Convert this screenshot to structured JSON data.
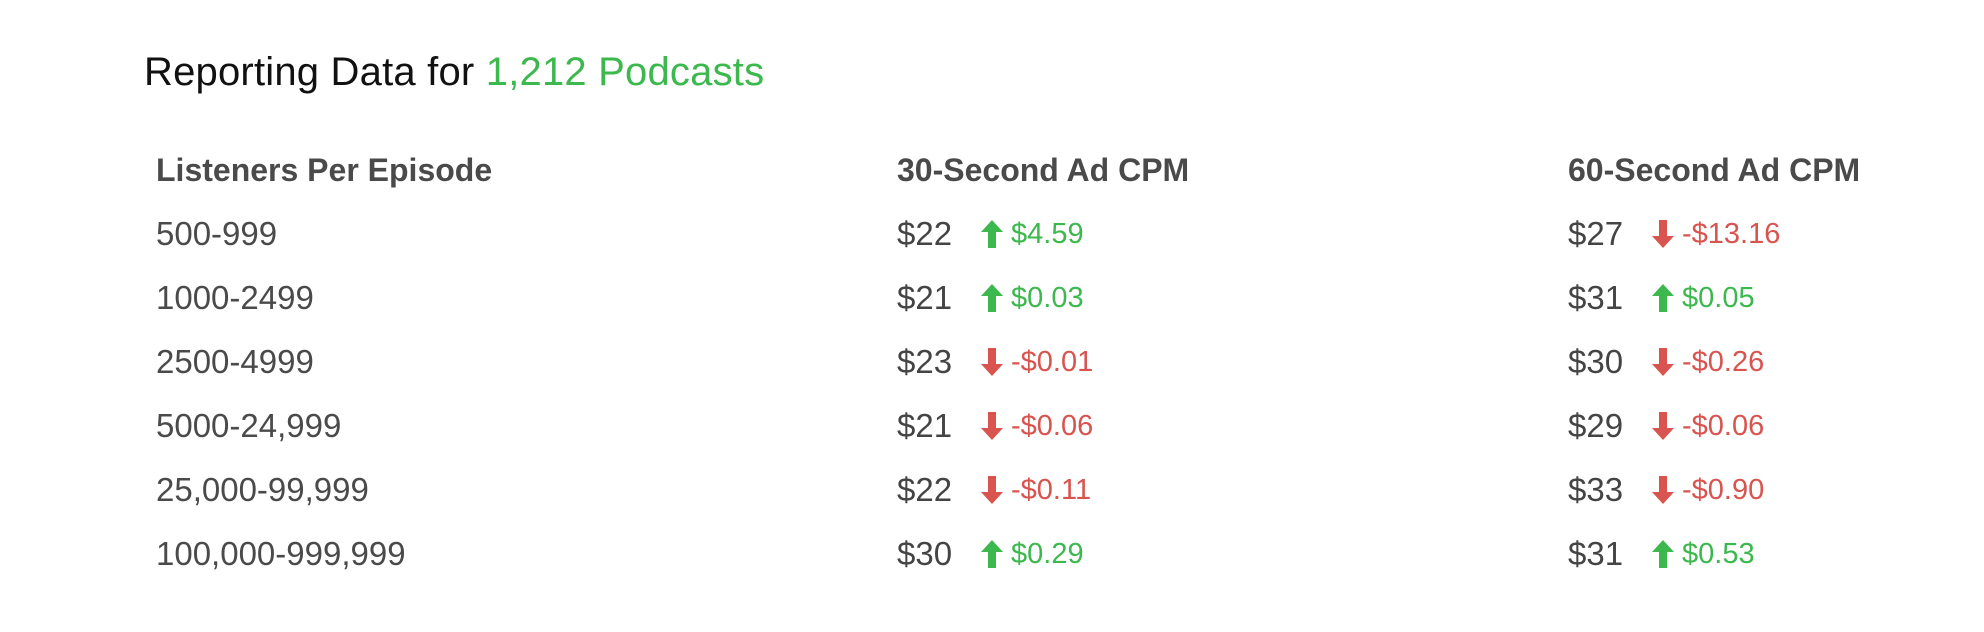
{
  "title": {
    "prefix": "Reporting Data for ",
    "highlight": "1,212 Podcasts"
  },
  "colors": {
    "up": "#3cb84f",
    "down": "#d9534f",
    "text": "#4a4a4a"
  },
  "icons": {
    "up": "arrow-up-icon",
    "down": "arrow-down-icon"
  },
  "table": {
    "headers": [
      "Listeners Per Episode",
      "30-Second Ad CPM",
      "60-Second Ad CPM"
    ],
    "rows": [
      {
        "listeners": "500-999",
        "cpm30": {
          "price": "$22",
          "change": "$4.59",
          "direction": "up"
        },
        "cpm60": {
          "price": "$27",
          "change": "-$13.16",
          "direction": "down"
        }
      },
      {
        "listeners": "1000-2499",
        "cpm30": {
          "price": "$21",
          "change": "$0.03",
          "direction": "up"
        },
        "cpm60": {
          "price": "$31",
          "change": "$0.05",
          "direction": "up"
        }
      },
      {
        "listeners": "2500-4999",
        "cpm30": {
          "price": "$23",
          "change": "-$0.01",
          "direction": "down"
        },
        "cpm60": {
          "price": "$30",
          "change": "-$0.26",
          "direction": "down"
        }
      },
      {
        "listeners": "5000-24,999",
        "cpm30": {
          "price": "$21",
          "change": "-$0.06",
          "direction": "down"
        },
        "cpm60": {
          "price": "$29",
          "change": "-$0.06",
          "direction": "down"
        }
      },
      {
        "listeners": "25,000-99,999",
        "cpm30": {
          "price": "$22",
          "change": "-$0.11",
          "direction": "down"
        },
        "cpm60": {
          "price": "$33",
          "change": "-$0.90",
          "direction": "down"
        }
      },
      {
        "listeners": "100,000-999,999",
        "cpm30": {
          "price": "$30",
          "change": "$0.29",
          "direction": "up"
        },
        "cpm60": {
          "price": "$31",
          "change": "$0.53",
          "direction": "up"
        }
      }
    ]
  }
}
